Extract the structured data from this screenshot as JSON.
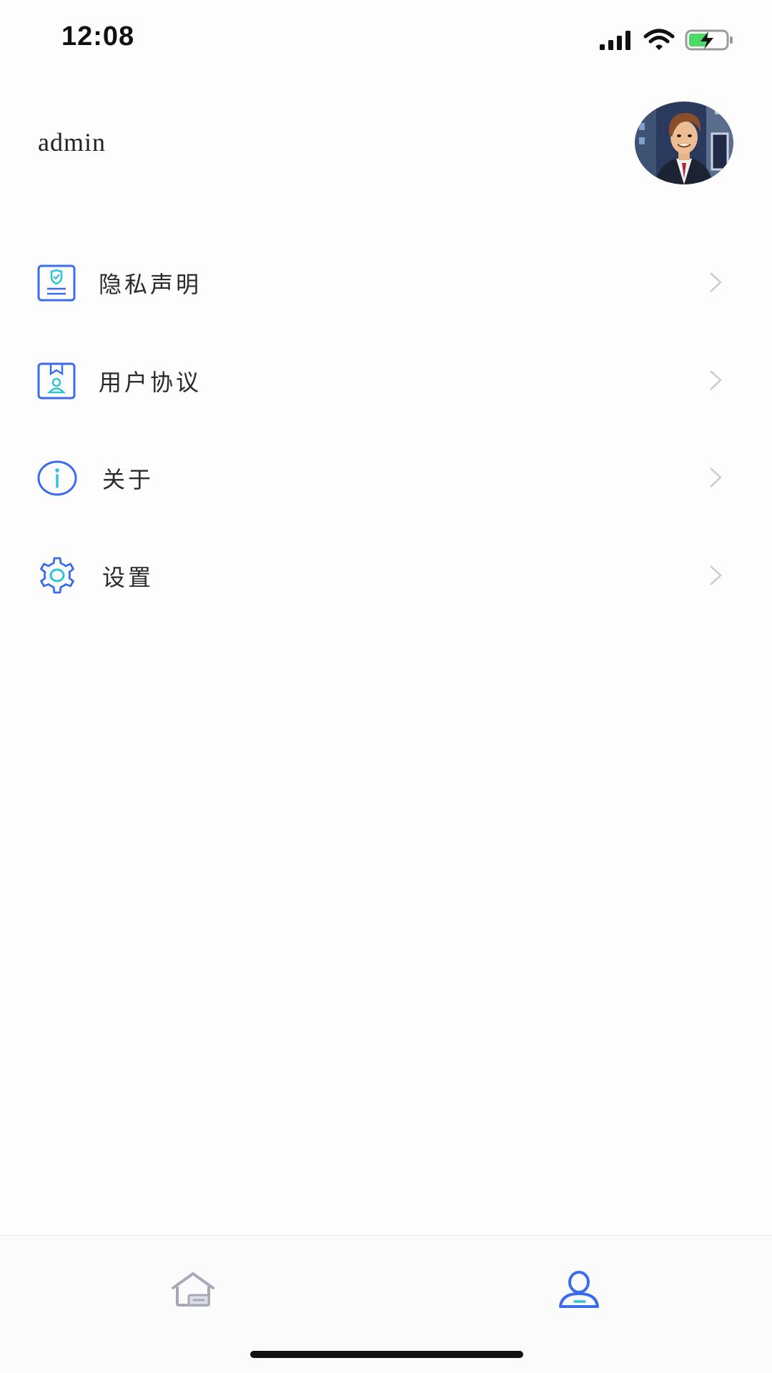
{
  "status_bar": {
    "time": "12:08",
    "icons": [
      "signal-icon",
      "wifi-icon",
      "battery-charging-icon"
    ]
  },
  "profile": {
    "username": "admin",
    "avatar": "cartoon-avatar"
  },
  "menu": {
    "items": [
      {
        "label": "隐私声明",
        "icon": "privacy-shield-document-icon"
      },
      {
        "label": "用户协议",
        "icon": "user-agreement-document-icon"
      },
      {
        "label": "关于",
        "icon": "info-circle-icon"
      },
      {
        "label": "设置",
        "icon": "gear-icon"
      }
    ],
    "chevron_icon": "chevron-right-icon"
  },
  "tab_bar": {
    "tabs": [
      {
        "name": "home",
        "icon": "home-icon",
        "active": false
      },
      {
        "name": "profile",
        "icon": "user-icon",
        "active": true
      }
    ]
  },
  "colors": {
    "accent_blue": "#3b6cf0",
    "accent_cyan": "#2ec4d6",
    "inactive_gray": "#a7aab6",
    "chevron_gray": "#c9cbd1",
    "background": "#fdfdfe"
  }
}
